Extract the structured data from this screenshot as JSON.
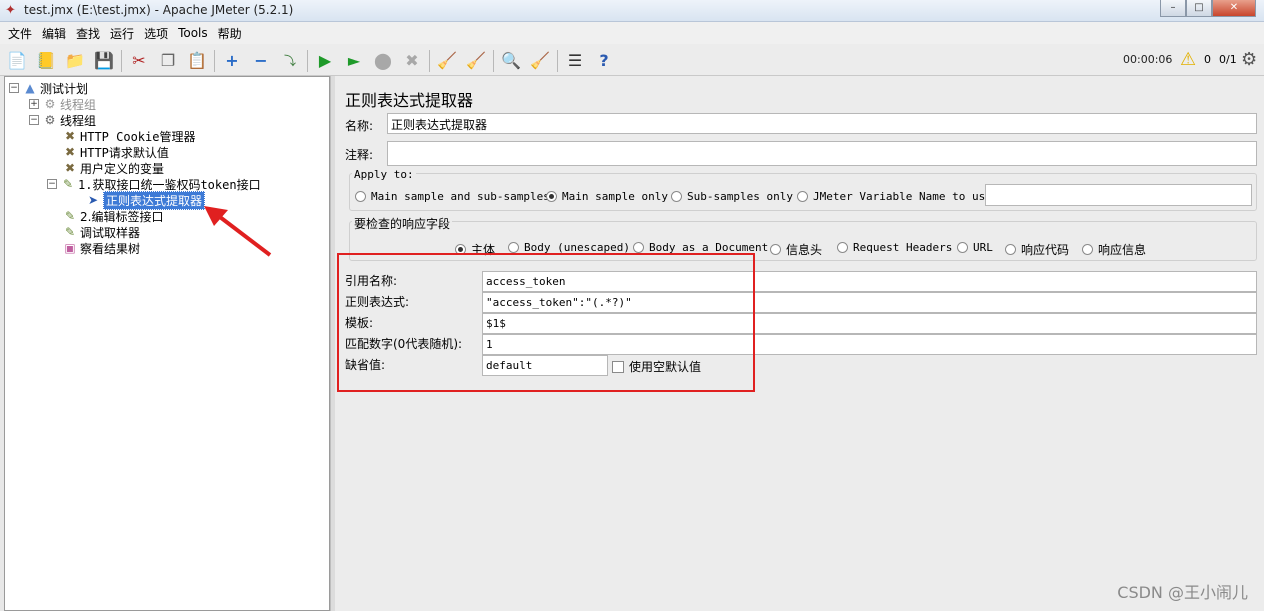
{
  "window": {
    "title": "test.jmx (E:\\test.jmx) - Apache JMeter (5.2.1)",
    "minimize": "–",
    "maximize": "□",
    "close": "✕"
  },
  "menu": [
    "文件",
    "编辑",
    "查找",
    "运行",
    "选项",
    "Tools",
    "帮助"
  ],
  "toolbar": {
    "timer": "00:00:06",
    "warning_count": "0",
    "threads": "0/1",
    "icons": [
      "new-icon",
      "templates-icon",
      "open-icon",
      "save-icon",
      "cut-icon",
      "copy-icon",
      "paste-icon",
      "expand-icon",
      "collapse-icon",
      "toggle-icon",
      "start-icon",
      "start-no-pause-icon",
      "stop-icon",
      "shutdown-icon",
      "clear-icon",
      "clear-all-icon",
      "search-icon",
      "reset-search-icon",
      "function-helper-icon",
      "help-icon"
    ]
  },
  "tree": {
    "items": [
      {
        "label": "测试计划",
        "icon": "test-plan-icon"
      },
      {
        "label": "线程组",
        "icon": "thread-group-icon",
        "disabled": true
      },
      {
        "label": "线程组",
        "icon": "thread-group-icon"
      },
      {
        "label": "HTTP Cookie管理器",
        "icon": "config-icon"
      },
      {
        "label": "HTTP请求默认值",
        "icon": "config-icon"
      },
      {
        "label": "用户定义的变量",
        "icon": "config-icon"
      },
      {
        "label": "1.获取接口统一鉴权码token接口",
        "icon": "sampler-icon"
      },
      {
        "label": "正则表达式提取器",
        "icon": "extractor-icon",
        "selected": true
      },
      {
        "label": "2.编辑标签接口",
        "icon": "sampler-icon"
      },
      {
        "label": "调试取样器",
        "icon": "sampler-icon"
      },
      {
        "label": "察看结果树",
        "icon": "listener-icon"
      }
    ]
  },
  "panel": {
    "title": "正则表达式提取器",
    "name_label": "名称:",
    "name_value": "正则表达式提取器",
    "comment_label": "注释:",
    "comment_value": "",
    "apply_to": {
      "title": "Apply to:",
      "options": [
        "Main sample and sub-samples",
        "Main sample only",
        "Sub-samples only",
        "JMeter Variable Name to use"
      ],
      "selected": "Main sample only",
      "variable_value": ""
    },
    "field_to_check": {
      "title": "要检查的响应字段",
      "options": [
        "主体",
        "Body (unescaped)",
        "Body as a Document",
        "信息头",
        "Request Headers",
        "URL",
        "响应代码",
        "响应信息"
      ],
      "selected": "主体"
    },
    "ref_name_label": "引用名称:",
    "ref_name_value": "access_token",
    "regex_label": "正则表达式:",
    "regex_value": "\"access_token\":\"(.*?)\"",
    "template_label": "模板:",
    "template_value": "$1$",
    "match_no_label": "匹配数字(0代表随机):",
    "match_no_value": "1",
    "default_label": "缺省值:",
    "default_value": "default",
    "use_empty_label": "使用空默认值",
    "use_empty_checked": false
  },
  "watermark": "CSDN @王小闹儿",
  "colors": {
    "annotation": "#e02020",
    "selection": "#3d7ad6"
  }
}
